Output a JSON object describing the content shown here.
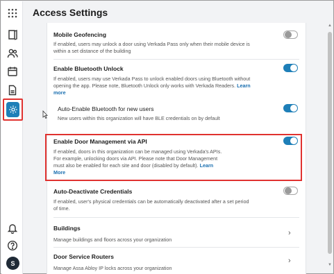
{
  "page": {
    "title": "Access Settings"
  },
  "sidebar": {
    "items": [
      {
        "name": "apps-grid",
        "icon": "grid-icon"
      },
      {
        "name": "doors",
        "icon": "door-icon"
      },
      {
        "name": "users",
        "icon": "users-icon"
      },
      {
        "name": "calendar",
        "icon": "calendar-icon"
      },
      {
        "name": "reports",
        "icon": "document-icon"
      },
      {
        "name": "settings",
        "icon": "gear-icon",
        "active": true
      },
      {
        "name": "notifications",
        "icon": "bell-icon"
      },
      {
        "name": "help",
        "icon": "help-icon"
      }
    ],
    "avatar_initial": "S"
  },
  "settings": {
    "mobile_geofencing": {
      "title": "Mobile Geofencing",
      "desc": "If enabled, users may unlock a door using Verkada Pass only when their mobile device is within a set distance of the building",
      "enabled": false
    },
    "bluetooth_unlock": {
      "title": "Enable Bluetooth Unlock",
      "desc": "If enabled, users may use Verkada Pass to unlock enabled doors using Bluetooth without opening the app. Please note, Bluetooth Unlock only works with Verkada Readers.",
      "link": "Learn more",
      "enabled": true
    },
    "auto_bluetooth": {
      "title": "Auto-Enable Bluetooth for new users",
      "desc": "New users within this organization will have BLE credentials on by default",
      "enabled": true
    },
    "door_management_api": {
      "title": "Enable Door Management via API",
      "desc": "If enabled, doors in this organization can be managed using Verkada's APIs. For example, unlocking doors via API. Please note that Door Management must also be enabled for each site and door (disabled by default).",
      "link": "Learn More",
      "enabled": true
    },
    "auto_deactivate": {
      "title": "Auto-Deactivate Credentials",
      "desc": "If enabled, user's physical credentials can be automatically deactivated after a set period of time.",
      "enabled": false
    },
    "buildings": {
      "title": "Buildings",
      "desc": "Manage buildings and floors across your organization"
    },
    "door_service_routers": {
      "title": "Door Service Routers",
      "desc": "Manage Assa Abloy IP locks across your organization"
    }
  },
  "colors": {
    "accent": "#1e7fb8",
    "highlight": "#e0312f"
  }
}
